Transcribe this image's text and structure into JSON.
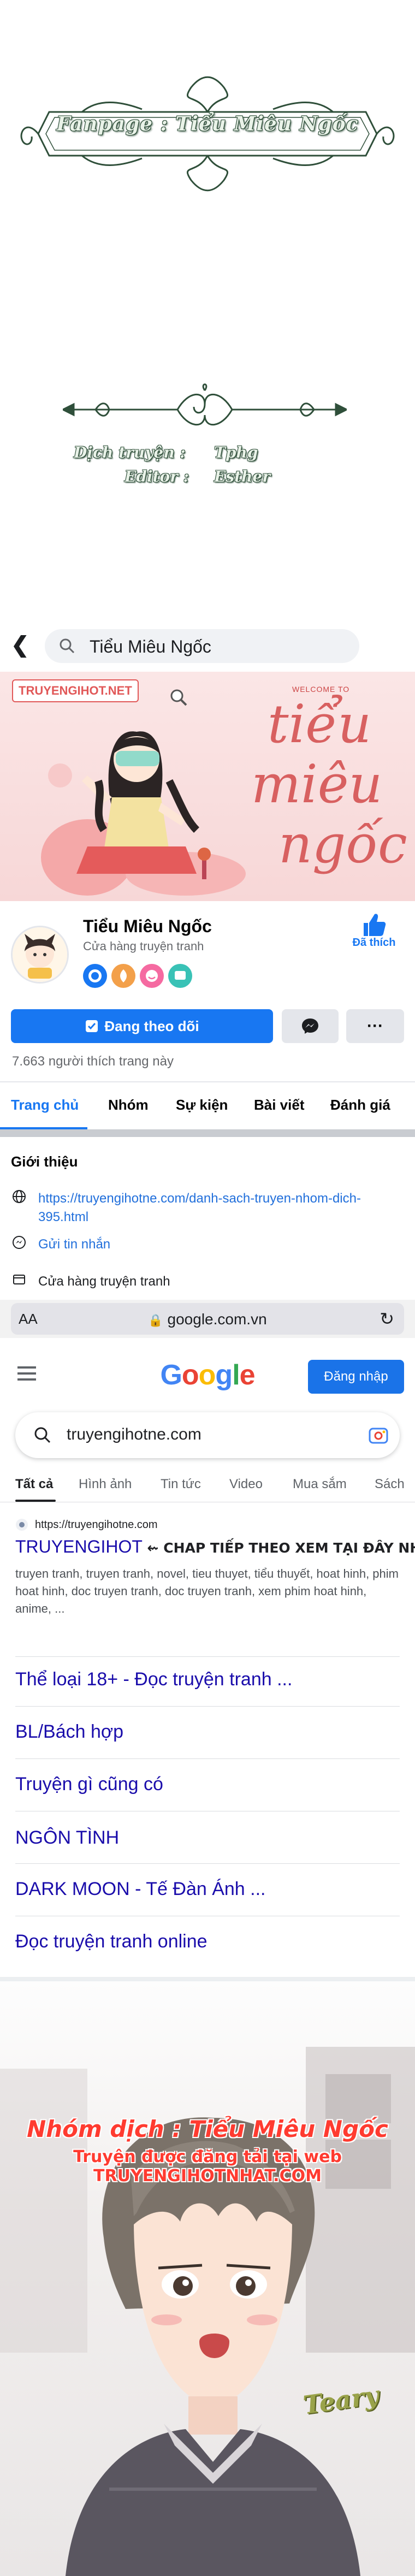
{
  "credit": {
    "fanpage": "Fanpage : Tiểu Miêu Ngốc",
    "translator_label": "Dịch truyện :",
    "translator_name": "Tphg",
    "editor_label": "Editor :",
    "editor_name": "Esther"
  },
  "facebook": {
    "search_text": "Tiểu Miêu Ngốc",
    "cover": {
      "logo": "TRUYENGIHOT.NET",
      "welcome": "WELCOME TO",
      "script_line1": "tiểu",
      "script_line2": "miêu",
      "script_line3": "ngốc"
    },
    "page_name": "Tiểu Miêu Ngốc",
    "category": "Cửa hàng truyện tranh",
    "liked_label": "Đã thích",
    "follow_label": "Đang theo dõi",
    "likes_text": "7.663 người thích trang này",
    "tabs": [
      "Trang chủ",
      "Nhóm",
      "Sự kiện",
      "Bài viết",
      "Đánh giá"
    ],
    "intro": {
      "title": "Giới thiệu",
      "link": "https://truyengihotne.com/danh-sach-truyen-nhom-dich-395.html",
      "message": "Gửi tin nhắn",
      "shop": "Cửa hàng truyện tranh"
    },
    "colors": {
      "brand": "#1877f2"
    }
  },
  "browser": {
    "aa": "AA",
    "url": "google.com.vn"
  },
  "google": {
    "logo_letters": [
      "G",
      "o",
      "o",
      "g",
      "l",
      "e"
    ],
    "logo_colors": [
      "#4285F4",
      "#EA4335",
      "#FBBC05",
      "#4285F4",
      "#34A853",
      "#EA4335"
    ],
    "login_label": "Đăng nhập",
    "query": "truyengihotne.com",
    "tabs": [
      "Tất cả",
      "Hình ảnh",
      "Tin tức",
      "Video",
      "Mua sắm",
      "Sách"
    ],
    "result": {
      "site": "https://truyengihotne.com",
      "title_main": "TRUYENGIHOT",
      "title_extra": " ⇜ CHAP TIẾP THEO XEM TẠI ĐÂY NHA",
      "snippet": "truyen tranh, truyen tranh, novel, tieu thuyet, tiểu thuyết, hoat hinh, phim hoat hinh, doc truyen tranh, doc truyen tranh, xem phim hoat hinh, anime, ...",
      "sitelinks": [
        "Thể loại 18+ - Đọc truyện tranh ...",
        "BL/Bách hợp",
        "Truyện gì cũng có",
        "NGÔN TÌNH",
        "DARK MOON - Tế Đàn Ánh ...",
        "Đọc truyện tranh online"
      ]
    }
  },
  "manga": {
    "team": "Nhóm dịch : Tiểu Miêu Ngốc",
    "posted": "Truyện được đăng tải tại web TRUYENGIHOTNHAT.COM",
    "sfx": "Teary"
  }
}
